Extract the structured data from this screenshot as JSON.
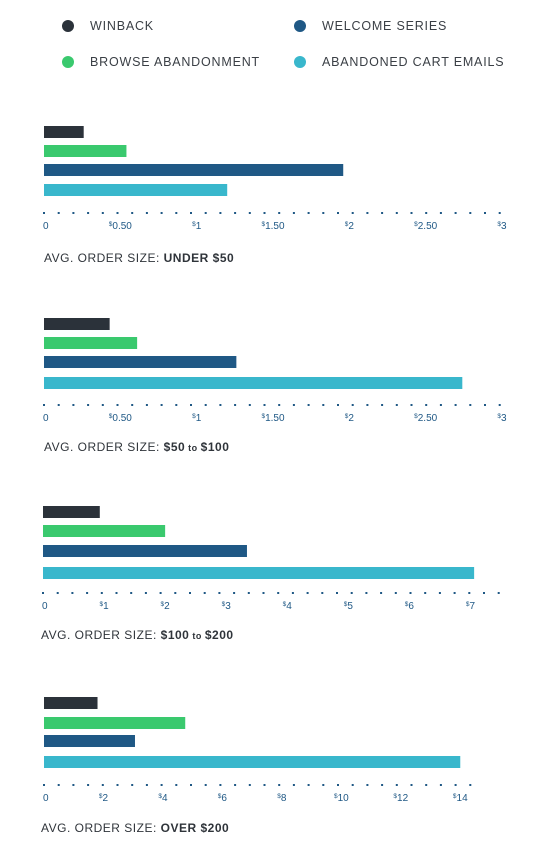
{
  "legend": [
    {
      "label": "WINBACK",
      "color": "#2b323a"
    },
    {
      "label": "WELCOME SERIES",
      "color": "#1f5885"
    },
    {
      "label": "BROWSE ABANDONMENT",
      "color": "#3ac96e"
    },
    {
      "label": "ABANDONED CART EMAILS",
      "color": "#39b7cc"
    }
  ],
  "axis_color": "#1f5885",
  "chart_data": [
    {
      "type": "bar",
      "orientation": "horizontal",
      "title": "AVG. ORDER SIZE: UNDER $50",
      "caption_prefix": "AVG. ORDER SIZE: ",
      "caption_parts": [
        "UNDER $50"
      ],
      "categories": [
        "Winback",
        "Browse Abandonment",
        "Welcome Series",
        "Abandoned Cart Emails"
      ],
      "colors": [
        "#2b323a",
        "#3ac96e",
        "#1f5885",
        "#39b7cc"
      ],
      "values": [
        0.26,
        0.54,
        1.96,
        1.2
      ],
      "xlim": [
        0,
        3
      ],
      "ticks": [
        {
          "value": 0,
          "label": "0",
          "sup": ""
        },
        {
          "value": 0.5,
          "label": "0.50",
          "sup": "$"
        },
        {
          "value": 1,
          "label": "1",
          "sup": "$"
        },
        {
          "value": 1.5,
          "label": "1.50",
          "sup": "$"
        },
        {
          "value": 2,
          "label": "2",
          "sup": "$"
        },
        {
          "value": 2.5,
          "label": "2.50",
          "sup": "$"
        },
        {
          "value": 3,
          "label": "3",
          "sup": "$"
        }
      ],
      "grid": false
    },
    {
      "type": "bar",
      "orientation": "horizontal",
      "title": "AVG. ORDER SIZE: $50 to $100",
      "caption_prefix": "AVG. ORDER SIZE: ",
      "caption_parts": [
        "$50",
        " to ",
        "$100"
      ],
      "categories": [
        "Winback",
        "Browse Abandonment",
        "Welcome Series",
        "Abandoned Cart Emails"
      ],
      "colors": [
        "#2b323a",
        "#3ac96e",
        "#1f5885",
        "#39b7cc"
      ],
      "values": [
        0.43,
        0.61,
        1.26,
        2.74
      ],
      "xlim": [
        0,
        3
      ],
      "ticks": [
        {
          "value": 0,
          "label": "0",
          "sup": ""
        },
        {
          "value": 0.5,
          "label": "0.50",
          "sup": "$"
        },
        {
          "value": 1,
          "label": "1",
          "sup": "$"
        },
        {
          "value": 1.5,
          "label": "1.50",
          "sup": "$"
        },
        {
          "value": 2,
          "label": "2",
          "sup": "$"
        },
        {
          "value": 2.5,
          "label": "2.50",
          "sup": "$"
        },
        {
          "value": 3,
          "label": "3",
          "sup": "$"
        }
      ],
      "grid": false
    },
    {
      "type": "bar",
      "orientation": "horizontal",
      "title": "AVG. ORDER SIZE: $100 to $200",
      "caption_prefix": "AVG. ORDER SIZE: ",
      "caption_parts": [
        "$100",
        " to ",
        "$200"
      ],
      "categories": [
        "Winback",
        "Browse Abandonment",
        "Welcome Series",
        "Abandoned Cart Emails"
      ],
      "colors": [
        "#2b323a",
        "#3ac96e",
        "#1f5885",
        "#39b7cc"
      ],
      "values": [
        0.93,
        2.0,
        3.34,
        7.06
      ],
      "xlim": [
        0,
        7.5
      ],
      "ticks": [
        {
          "value": 0,
          "label": "0",
          "sup": ""
        },
        {
          "value": 1,
          "label": "1",
          "sup": "$"
        },
        {
          "value": 2,
          "label": "2",
          "sup": "$"
        },
        {
          "value": 3,
          "label": "3",
          "sup": "$"
        },
        {
          "value": 4,
          "label": "4",
          "sup": "$"
        },
        {
          "value": 5,
          "label": "5",
          "sup": "$"
        },
        {
          "value": 6,
          "label": "6",
          "sup": "$"
        },
        {
          "value": 7,
          "label": "7",
          "sup": "$"
        }
      ],
      "grid": false
    },
    {
      "type": "bar",
      "orientation": "horizontal",
      "title": "AVG. ORDER SIZE: OVER $200",
      "caption_prefix": "AVG. ORDER SIZE: ",
      "caption_parts": [
        "OVER $200"
      ],
      "categories": [
        "Winback",
        "Browse Abandonment",
        "Welcome Series",
        "Abandoned Cart Emails"
      ],
      "colors": [
        "#2b323a",
        "#3ac96e",
        "#1f5885",
        "#39b7cc"
      ],
      "values": [
        1.8,
        4.75,
        3.06,
        14.0
      ],
      "xlim": [
        0,
        15
      ],
      "ticks": [
        {
          "value": 0,
          "label": "0",
          "sup": ""
        },
        {
          "value": 2,
          "label": "2",
          "sup": "$"
        },
        {
          "value": 4,
          "label": "4",
          "sup": "$"
        },
        {
          "value": 6,
          "label": "6",
          "sup": "$"
        },
        {
          "value": 8,
          "label": "8",
          "sup": "$"
        },
        {
          "value": 10,
          "label": "10",
          "sup": "$"
        },
        {
          "value": 12,
          "label": "12",
          "sup": "$"
        },
        {
          "value": 14,
          "label": "14",
          "sup": "$"
        }
      ],
      "grid": false
    }
  ]
}
